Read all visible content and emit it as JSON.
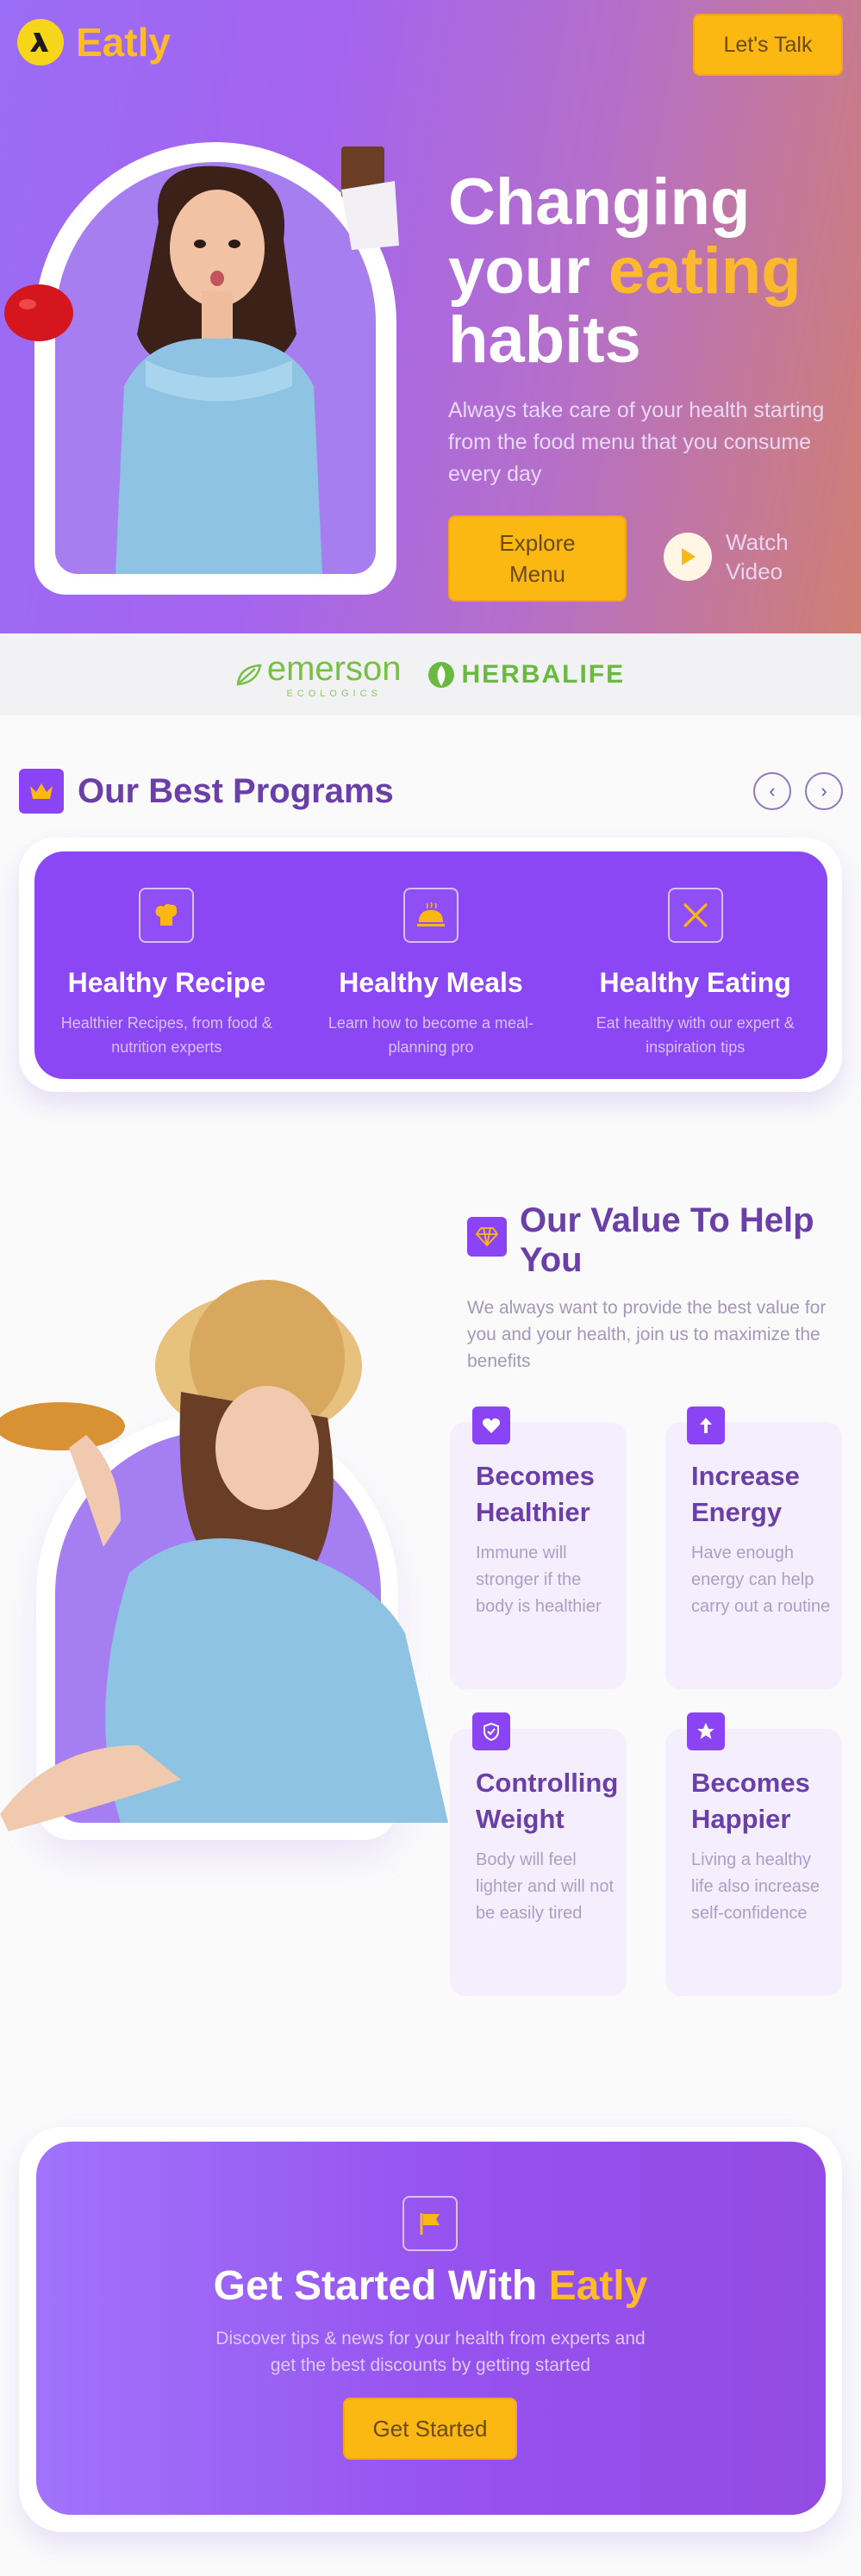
{
  "brand": {
    "name": "Eatly"
  },
  "header": {
    "cta_label": "Let's Talk"
  },
  "hero": {
    "title_part1": "Changing",
    "title_part2": "your",
    "title_accent": "eating",
    "title_part3": "habits",
    "subtitle": "Always take care of your health starting from the food menu that you consume every day",
    "primary_button": "Explore Menu",
    "video_label": "Watch Video"
  },
  "sponsors": [
    {
      "name": "emerson",
      "sub": "ECOLOGICS",
      "icon": "leaf-icon"
    },
    {
      "name": "HERBALIFE",
      "icon": "herbalife-leaf-icon"
    }
  ],
  "programs": {
    "title": "Our Best Programs",
    "items": [
      {
        "title": "Healthy Recipe",
        "desc": "Healthier Recipes, from food & nutrition experts",
        "icon": "chef-hat-icon"
      },
      {
        "title": "Healthy Meals",
        "desc": "Learn how to become a meal-planning pro",
        "icon": "serving-dish-icon"
      },
      {
        "title": "Healthy Eating",
        "desc": "Eat healthy with our expert & inspiration tips",
        "icon": "fork-knife-icon"
      }
    ]
  },
  "values": {
    "title": "Our Value To Help You",
    "subtitle": "We always want to provide the best value for you and your health, join us to maximize the benefits",
    "items": [
      {
        "title": "Becomes Healthier",
        "desc": "Immune will stronger if the body is healthier",
        "icon": "heart-icon"
      },
      {
        "title": "Increase Energy",
        "desc": "Have enough energy can help carry out a routine",
        "icon": "energy-icon"
      },
      {
        "title": "Controlling Weight",
        "desc": "Body will feel lighter and will not be easily tired",
        "icon": "shield-icon"
      },
      {
        "title": "Becomes Happier",
        "desc": "Living a healthy life also increase self-confidence",
        "icon": "star-icon"
      }
    ]
  },
  "cta": {
    "title": "Get Started With",
    "title_accent": "Eatly",
    "subtitle": "Discover tips & news for your health from experts and get the best discounts by getting started",
    "button": "Get Started"
  },
  "colors": {
    "purple": "#8c47f5",
    "accent": "#fbb813",
    "heading": "#6b3fa8"
  }
}
